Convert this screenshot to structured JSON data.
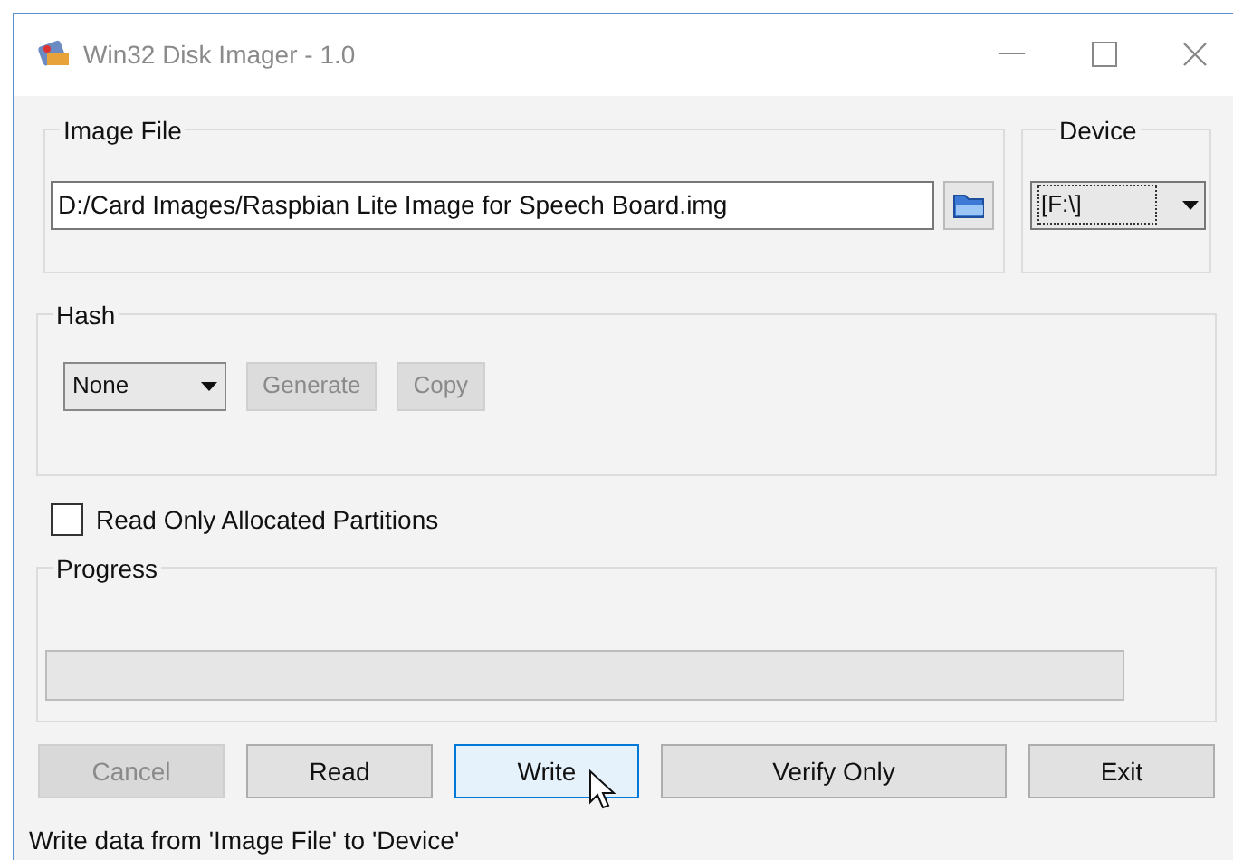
{
  "window": {
    "title": "Win32 Disk Imager - 1.0"
  },
  "image_file": {
    "label": "Image File",
    "value": "D:/Card Images/Raspbian Lite Image for Speech Board.img"
  },
  "device": {
    "label": "Device",
    "value": "[F:\\]"
  },
  "hash": {
    "label": "Hash",
    "select": "None",
    "buttons": [
      {
        "label": "Generate",
        "disabled": true
      },
      {
        "label": "Copy",
        "disabled": true
      }
    ]
  },
  "read_only_allocated": {
    "label": "Read Only Allocated Partitions",
    "checked": false
  },
  "progress": {
    "label": "Progress",
    "level": 0
  },
  "buttons": [
    {
      "label": "Cancel",
      "disabled": true,
      "focused": false
    },
    {
      "label": "Read",
      "disabled": false,
      "focused": false
    },
    {
      "label": "Write",
      "disabled": false,
      "focused": true
    },
    {
      "label": "Verify Only",
      "disabled": false,
      "focused": false
    },
    {
      "label": "Exit",
      "disabled": false,
      "focused": false
    }
  ],
  "status_bar": "Write data from 'Image File' to 'Device'"
}
